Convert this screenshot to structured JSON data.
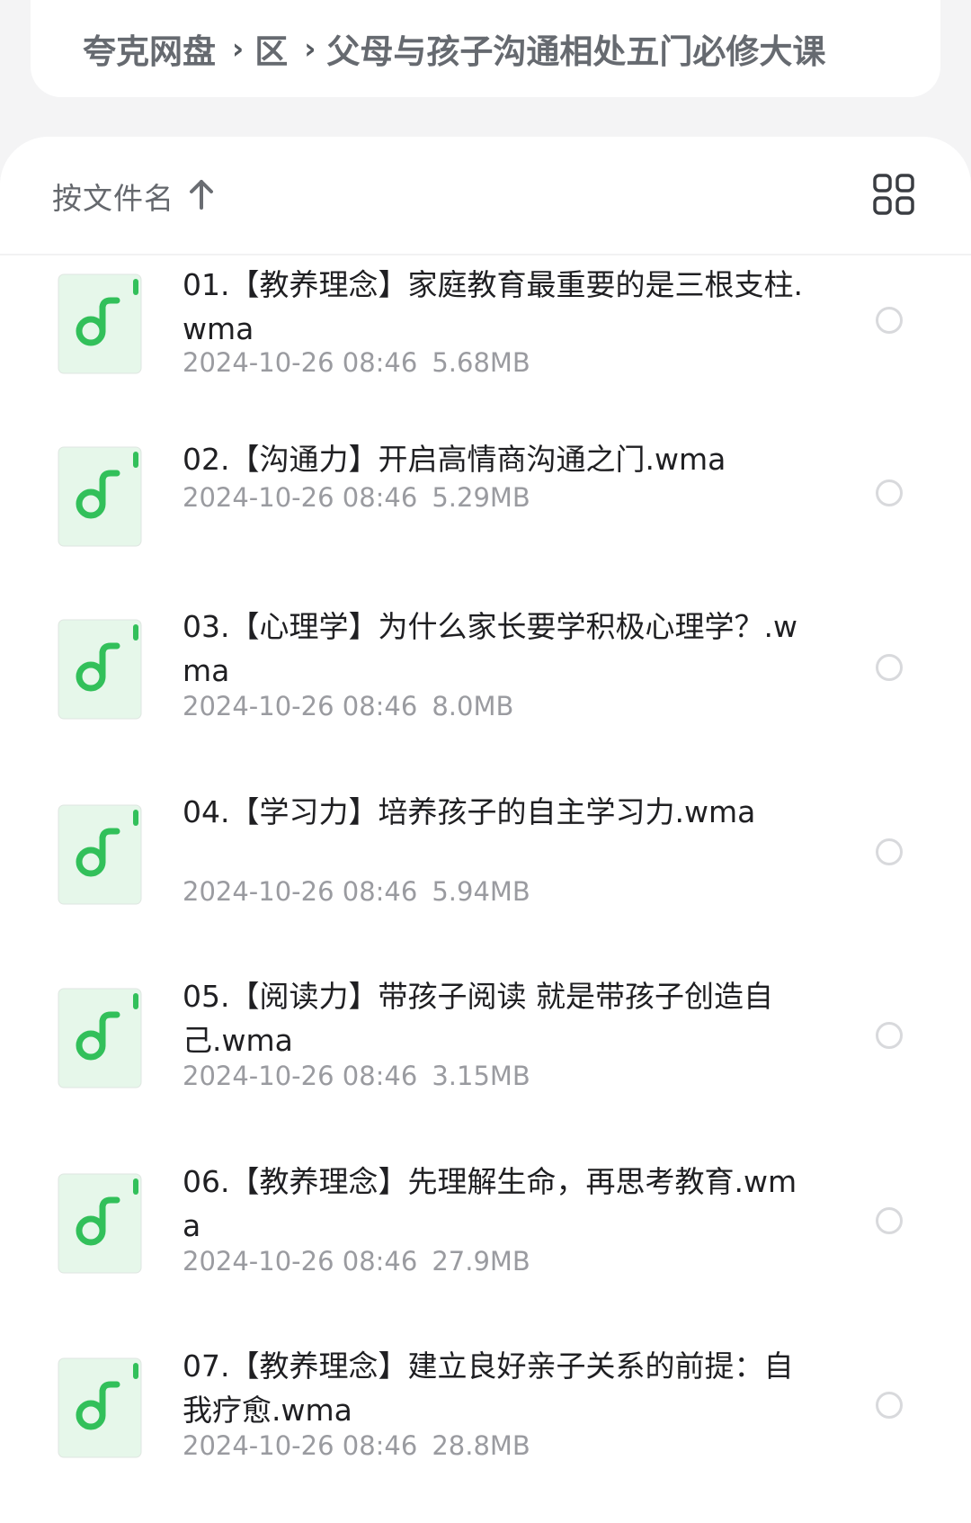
{
  "breadcrumb": {
    "items": [
      "夸克网盘",
      "区",
      "父母与孩子沟通相处五门必修大课"
    ],
    "separator": "›"
  },
  "sort_bar": {
    "label": "按文件名",
    "direction_icon": "arrow-up-icon",
    "view_toggle_icon": "grid-view-icon"
  },
  "colors": {
    "accent_green": "#32c05a",
    "icon_bg": "#e6f7ea",
    "title_text": "#1f1f22",
    "meta_text": "#9a9ba0",
    "radio_border": "#d8d9dc"
  },
  "files": [
    {
      "name": "01.【教养理念】家庭教育最重要的是三根支柱.wma",
      "date": "2024-10-26 08:46",
      "size": "5.68MB",
      "icon": "music-file-icon"
    },
    {
      "name": "02.【沟通力】开启高情商沟通之门.wma",
      "date": "2024-10-26 08:46",
      "size": "5.29MB",
      "icon": "music-file-icon"
    },
    {
      "name": "03.【心理学】为什么家长要学积极心理学？.wma",
      "date": "2024-10-26 08:46",
      "size": "8.0MB",
      "icon": "music-file-icon"
    },
    {
      "name": "04.【学习力】培养孩子的自主学习力.wma",
      "date": "2024-10-26 08:46",
      "size": "5.94MB",
      "icon": "music-file-icon"
    },
    {
      "name": "05.【阅读力】带孩子阅读 就是带孩子创造自己.wma",
      "date": "2024-10-26 08:46",
      "size": "3.15MB",
      "icon": "music-file-icon"
    },
    {
      "name": "06.【教养理念】先理解生命，再思考教育.wma",
      "date": "2024-10-26 08:46",
      "size": "27.9MB",
      "icon": "music-file-icon"
    },
    {
      "name": "07.【教养理念】建立良好亲子关系的前提：自我疗愈.wma",
      "date": "2024-10-26 08:46",
      "size": "28.8MB",
      "icon": "music-file-icon"
    }
  ]
}
